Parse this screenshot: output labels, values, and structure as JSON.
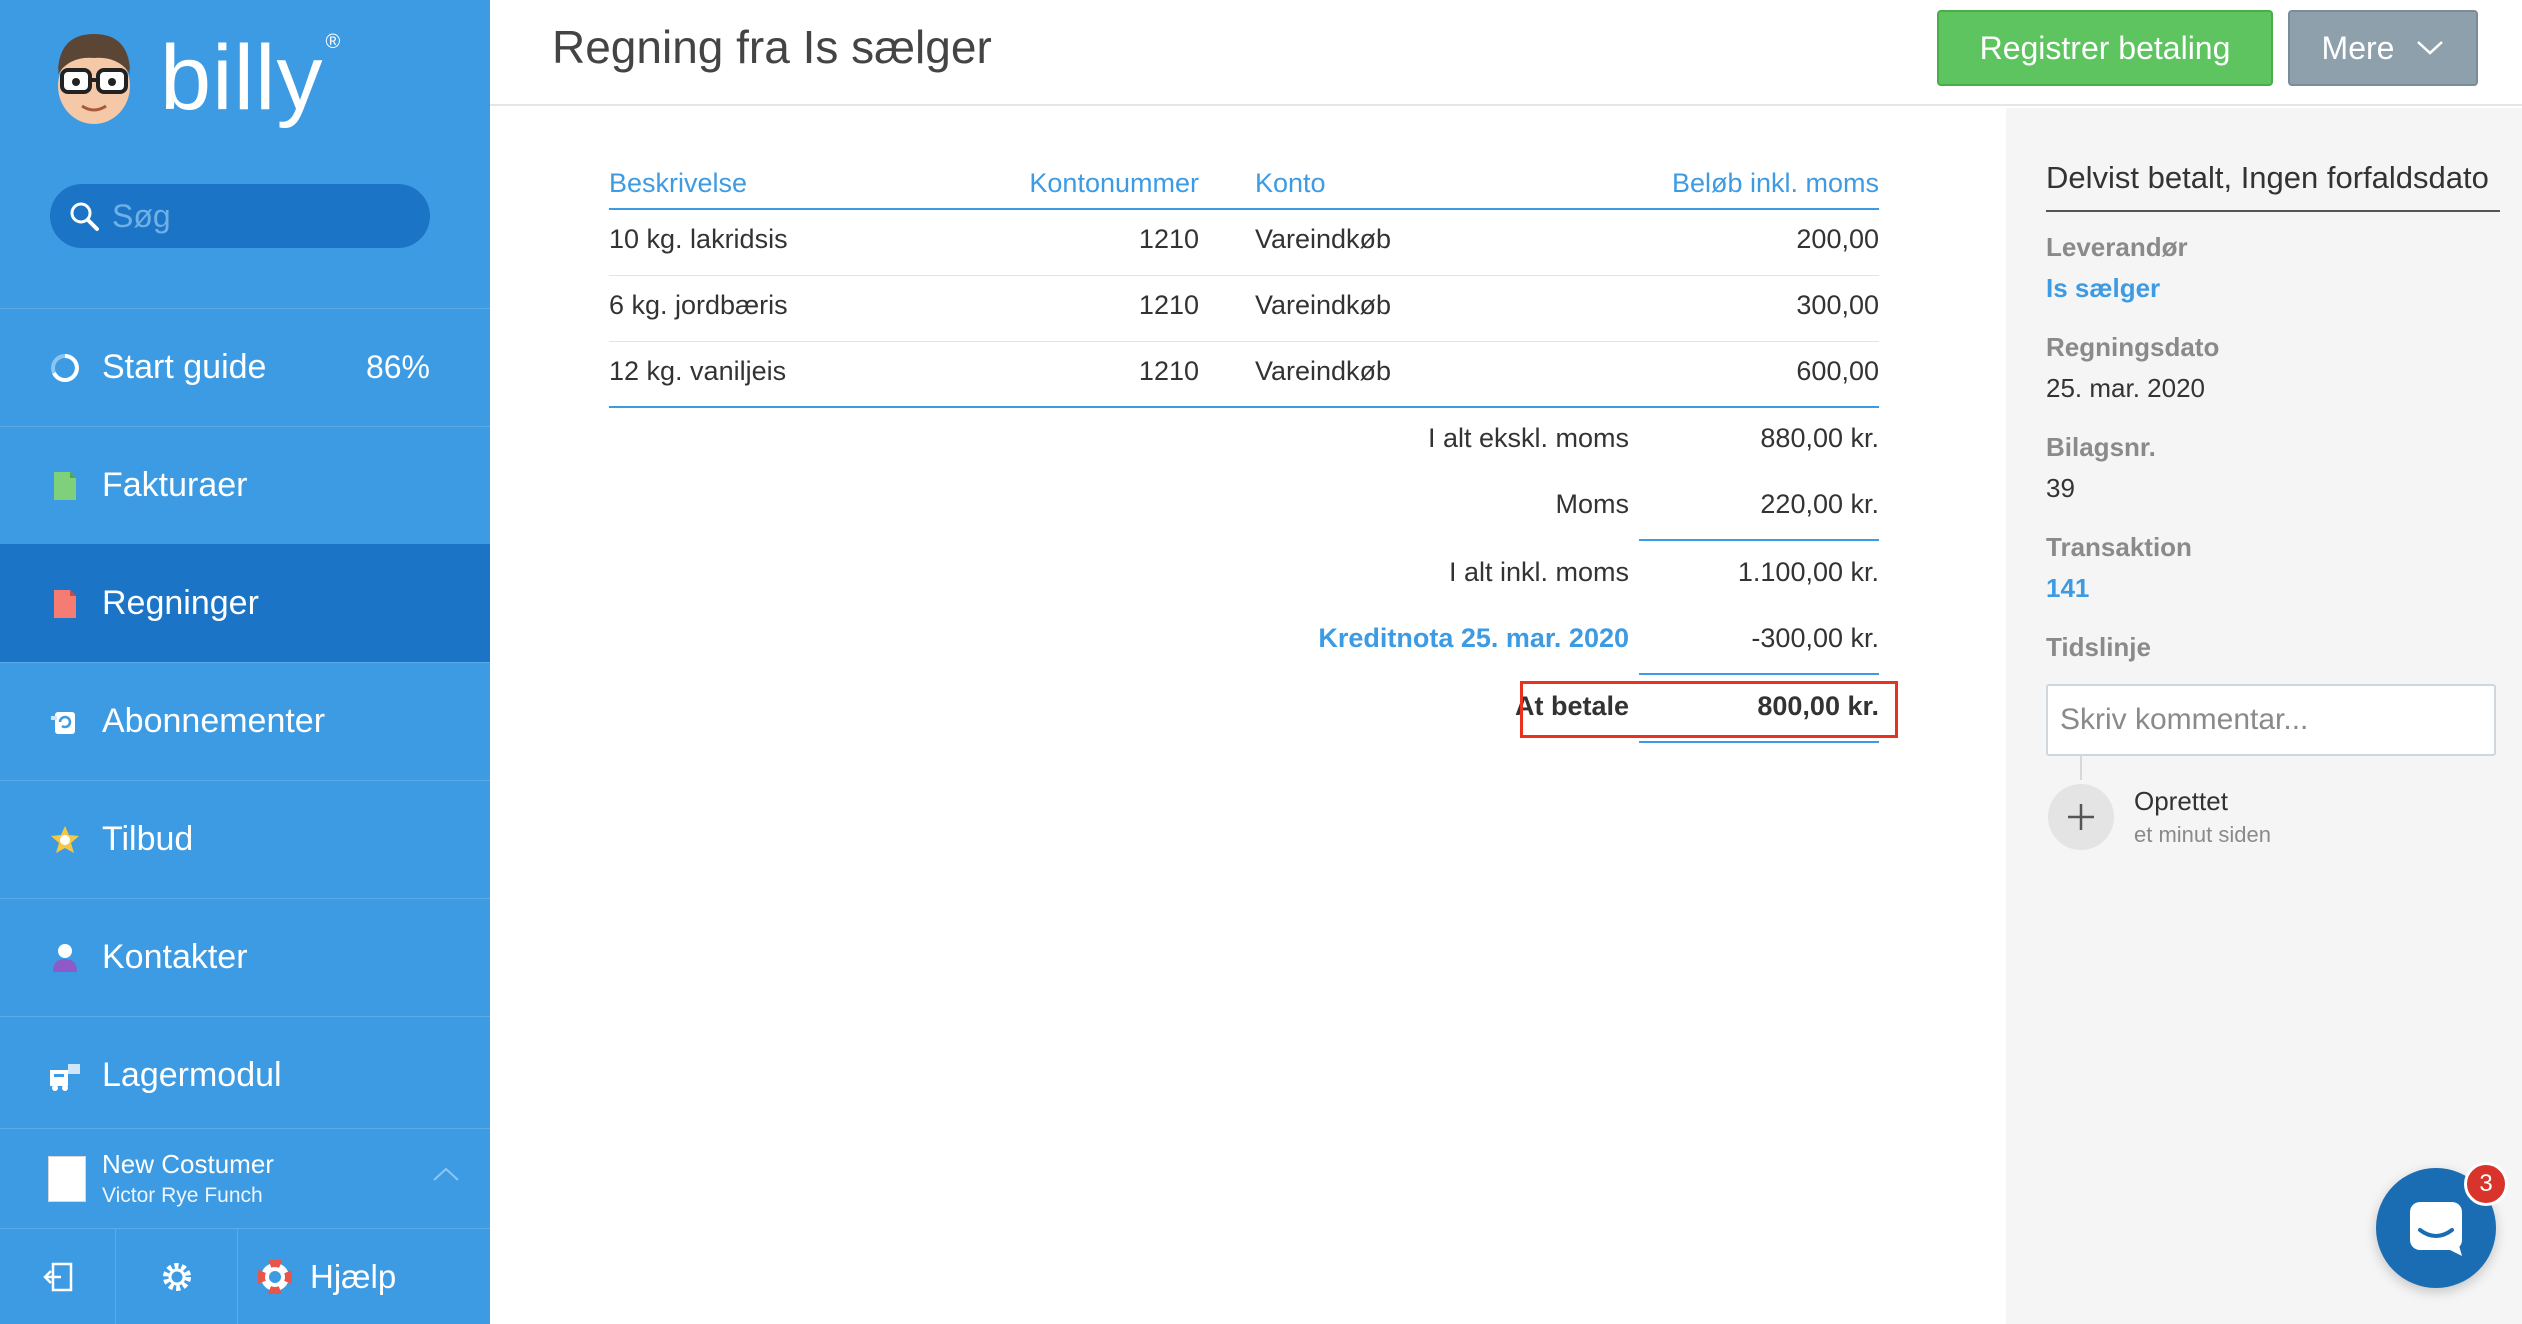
{
  "brand": {
    "name": "billy",
    "registered": "®"
  },
  "search": {
    "placeholder": "Søg"
  },
  "sidebar": {
    "items": [
      {
        "label": "Start guide",
        "badge": "86%",
        "icon": "progress-ring-icon"
      },
      {
        "label": "Fakturaer",
        "icon": "invoice-doc-icon"
      },
      {
        "label": "Regninger",
        "icon": "bill-doc-icon",
        "active": true
      },
      {
        "label": "Abonnementer",
        "icon": "subscription-icon"
      },
      {
        "label": "Tilbud",
        "icon": "star-badge-icon"
      },
      {
        "label": "Kontakter",
        "icon": "person-icon"
      },
      {
        "label": "Lagermodul",
        "icon": "inventory-icon"
      }
    ],
    "org": {
      "name": "New Costumer",
      "user": "Victor Rye Funch"
    },
    "help_label": "Hjælp"
  },
  "header": {
    "title": "Regning fra Is sælger",
    "pay_button": "Registrer betaling",
    "more_button": "Mere"
  },
  "table": {
    "headers": [
      "Beskrivelse",
      "Kontonummer",
      "Konto",
      "Beløb inkl. moms"
    ],
    "rows": [
      [
        "10 kg. lakridsis",
        "1210",
        "Vareindkøb",
        "200,00"
      ],
      [
        "6 kg. jordbæris",
        "1210",
        "Vareindkøb",
        "300,00"
      ],
      [
        "12 kg. vaniljeis",
        "1210",
        "Vareindkøb",
        "600,00"
      ]
    ]
  },
  "totals": {
    "excl_label": "I alt ekskl. moms",
    "excl_value": "880,00 kr.",
    "vat_label": "Moms",
    "vat_value": "220,00 kr.",
    "incl_label": "I alt inkl. moms",
    "incl_value": "1.100,00 kr.",
    "credit_label": "Kreditnota 25. mar. 2020",
    "credit_value": "-300,00 kr.",
    "due_label": "At betale",
    "due_value": "800,00 kr."
  },
  "panel": {
    "status": "Delvist betalt, Ingen forfaldsdato",
    "supplier_label": "Leverandør",
    "supplier_value": "Is sælger",
    "date_label": "Regningsdato",
    "date_value": "25. mar. 2020",
    "voucher_label": "Bilagsnr.",
    "voucher_value": "39",
    "transaction_label": "Transaktion",
    "transaction_value": "141",
    "timeline_label": "Tidslinje",
    "comment_placeholder": "Skriv kommentar...",
    "event_title": "Oprettet",
    "event_time": "et minut siden"
  },
  "chat": {
    "badge": "3"
  },
  "colors": {
    "sidebar": "#3d9be3",
    "sidebar_active": "#1b74c5",
    "accent": "#3d9be3",
    "pay_button": "#5dc460",
    "more_button": "#8fa0ad",
    "highlight": "#e8321e"
  }
}
